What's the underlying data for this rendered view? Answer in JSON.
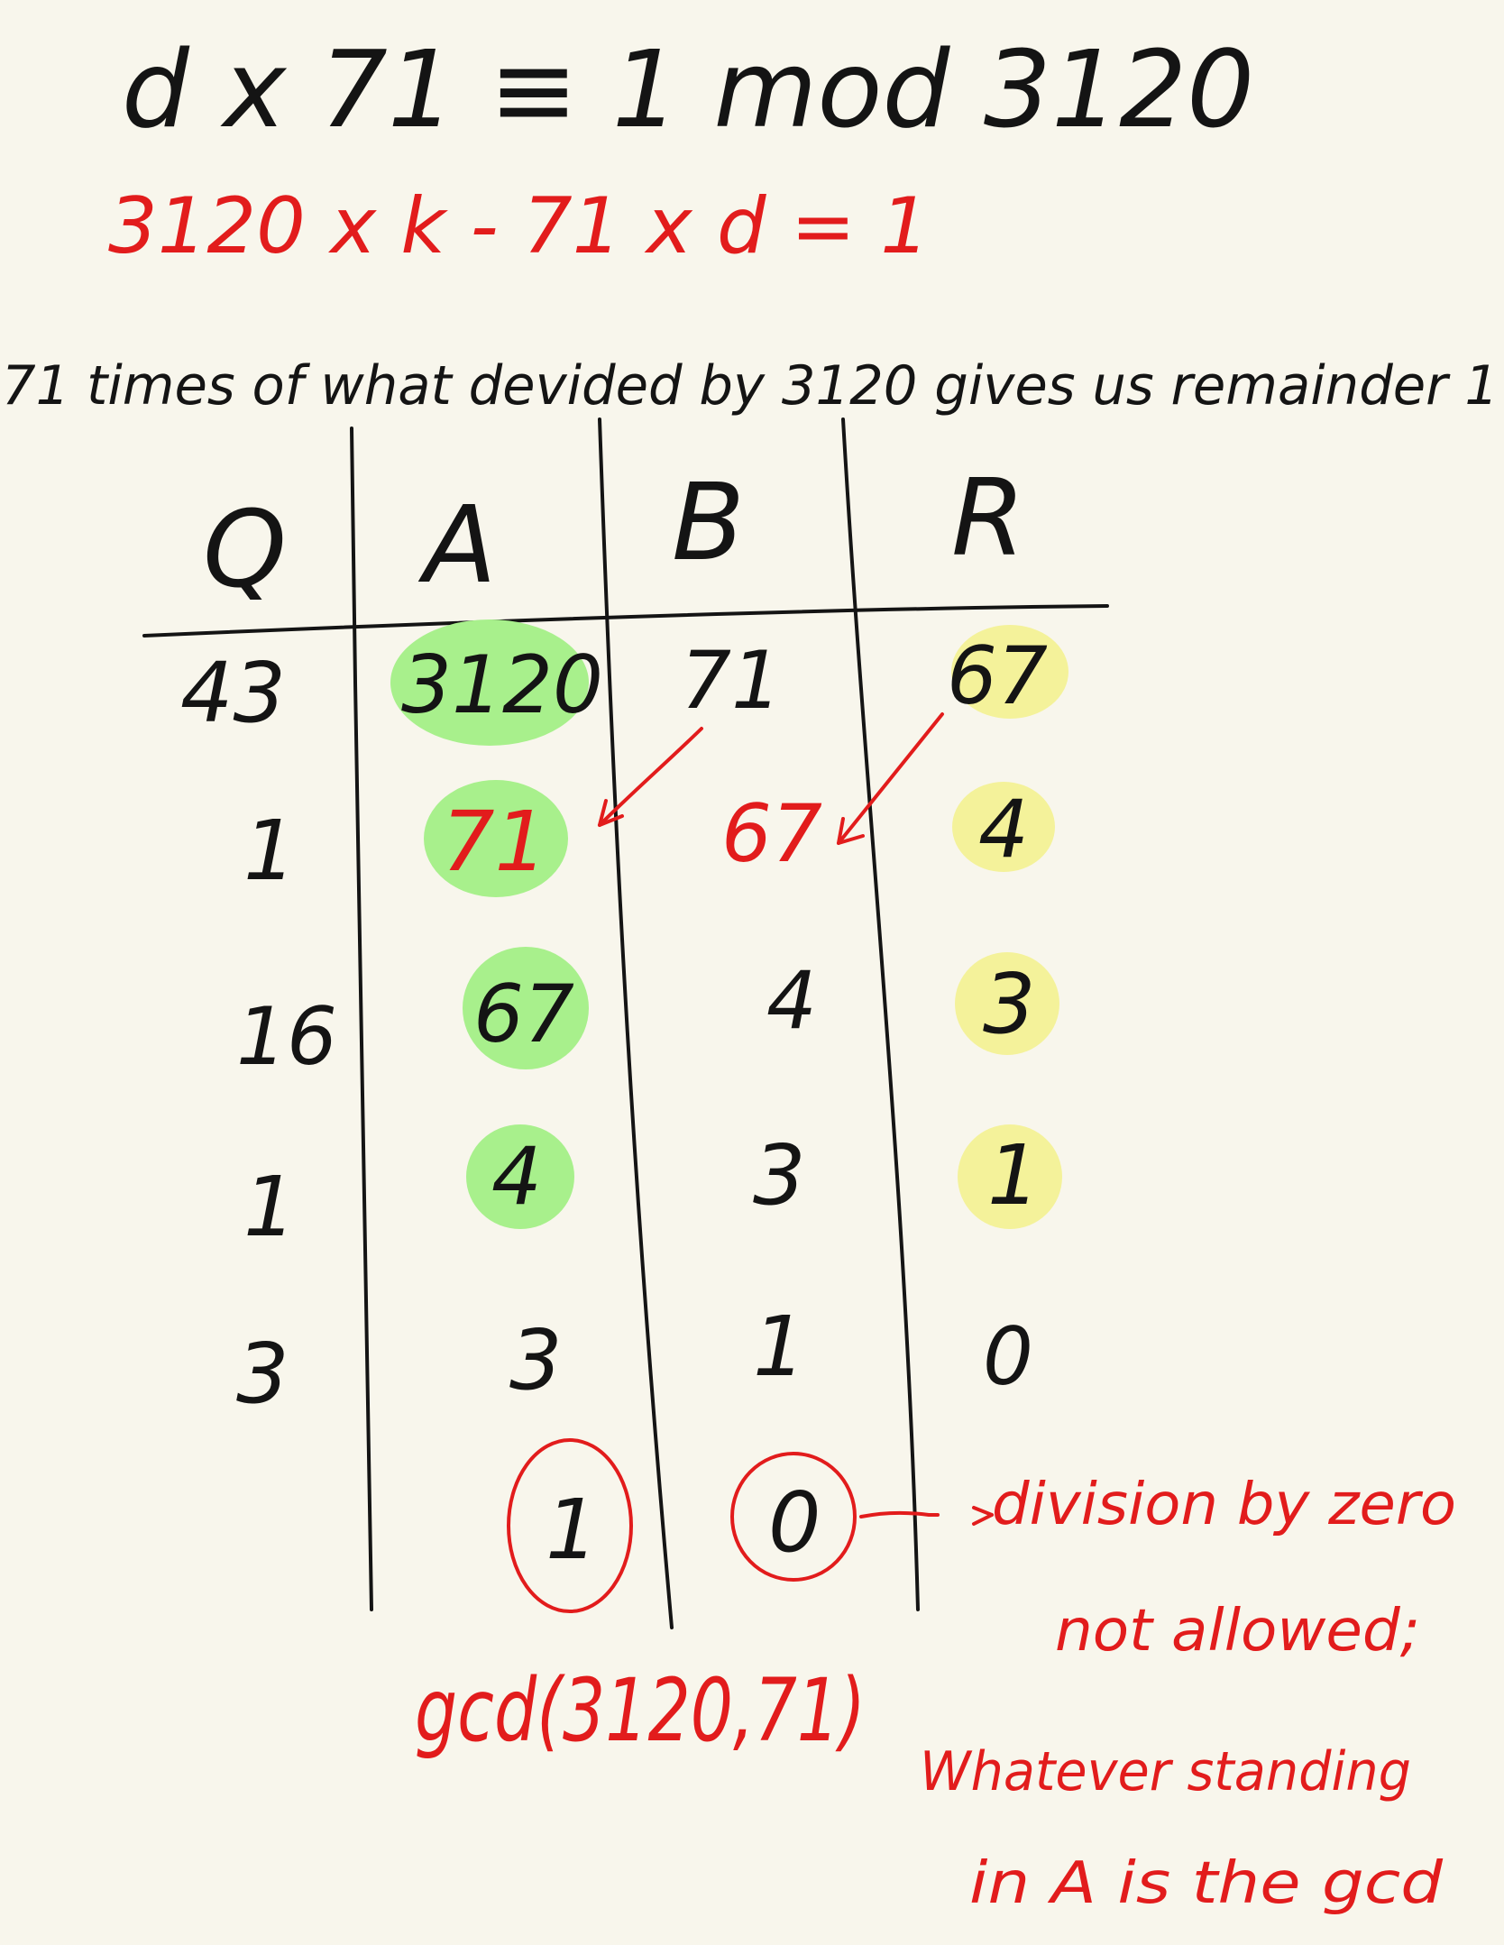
{
  "equation": "d x 71 ≡ 1 mod 3120",
  "rearranged": "3120 x k - 71 x d = 1",
  "question": "71 times of what devided by 3120 gives us remainder 1",
  "table": {
    "headers": [
      "Q",
      "A",
      "B",
      "R"
    ],
    "rows": [
      [
        "43",
        "3120",
        "71",
        "67"
      ],
      [
        "1",
        "71",
        "67",
        "4"
      ],
      [
        "16",
        "67",
        "4",
        "3"
      ],
      [
        "1",
        "4",
        "3",
        "1"
      ],
      [
        "3",
        "3",
        "1",
        "0"
      ]
    ],
    "final": {
      "A": "1",
      "B": "0"
    }
  },
  "gcd_label": "gcd(3120,71)",
  "note_lines": [
    "division by zero",
    "not allowed;",
    "Whatever standing",
    "in A is the gcd"
  ],
  "colors": {
    "ink": "#141414",
    "red": "#e21c1c",
    "green_highlight": "#a8f08c",
    "yellow_highlight": "#f4f29a",
    "paper": "#f8f6ec"
  }
}
